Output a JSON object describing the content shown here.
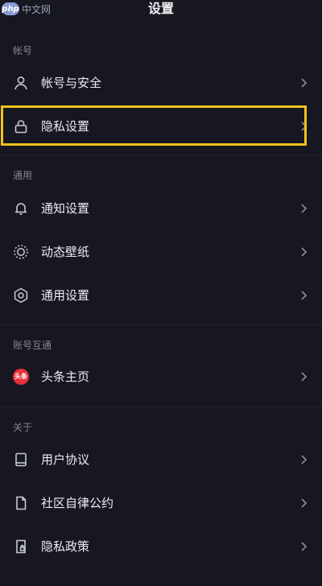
{
  "watermark": {
    "badge": "php",
    "text": "中文网"
  },
  "header": {
    "title": "设置"
  },
  "sections": {
    "account": {
      "label": "帐号",
      "items": {
        "account_security": "帐号与安全",
        "privacy_settings": "隐私设置"
      }
    },
    "general": {
      "label": "通用",
      "items": {
        "notification_settings": "通知设置",
        "dynamic_wallpaper": "动态壁纸",
        "general_settings": "通用设置"
      }
    },
    "linked_accounts": {
      "label": "账号互通",
      "items": {
        "toutiao_home": "头条主页",
        "toutiao_badge": "头条"
      }
    },
    "about": {
      "label": "关于",
      "items": {
        "user_agreement": "用户协议",
        "community_guidelines": "社区自律公约",
        "privacy_policy": "隐私政策"
      }
    }
  },
  "colors": {
    "background": "#161720",
    "highlight": "#f1c21b",
    "toutiao_red": "#e8303a"
  },
  "icons": {
    "account_security": "user-icon",
    "privacy_settings": "lock-icon",
    "notification_settings": "bell-icon",
    "dynamic_wallpaper": "sun-icon",
    "general_settings": "gear-icon",
    "toutiao_home": "toutiao-logo-icon",
    "user_agreement": "book-icon",
    "community_guidelines": "document-icon",
    "privacy_policy": "privacy-document-icon"
  }
}
